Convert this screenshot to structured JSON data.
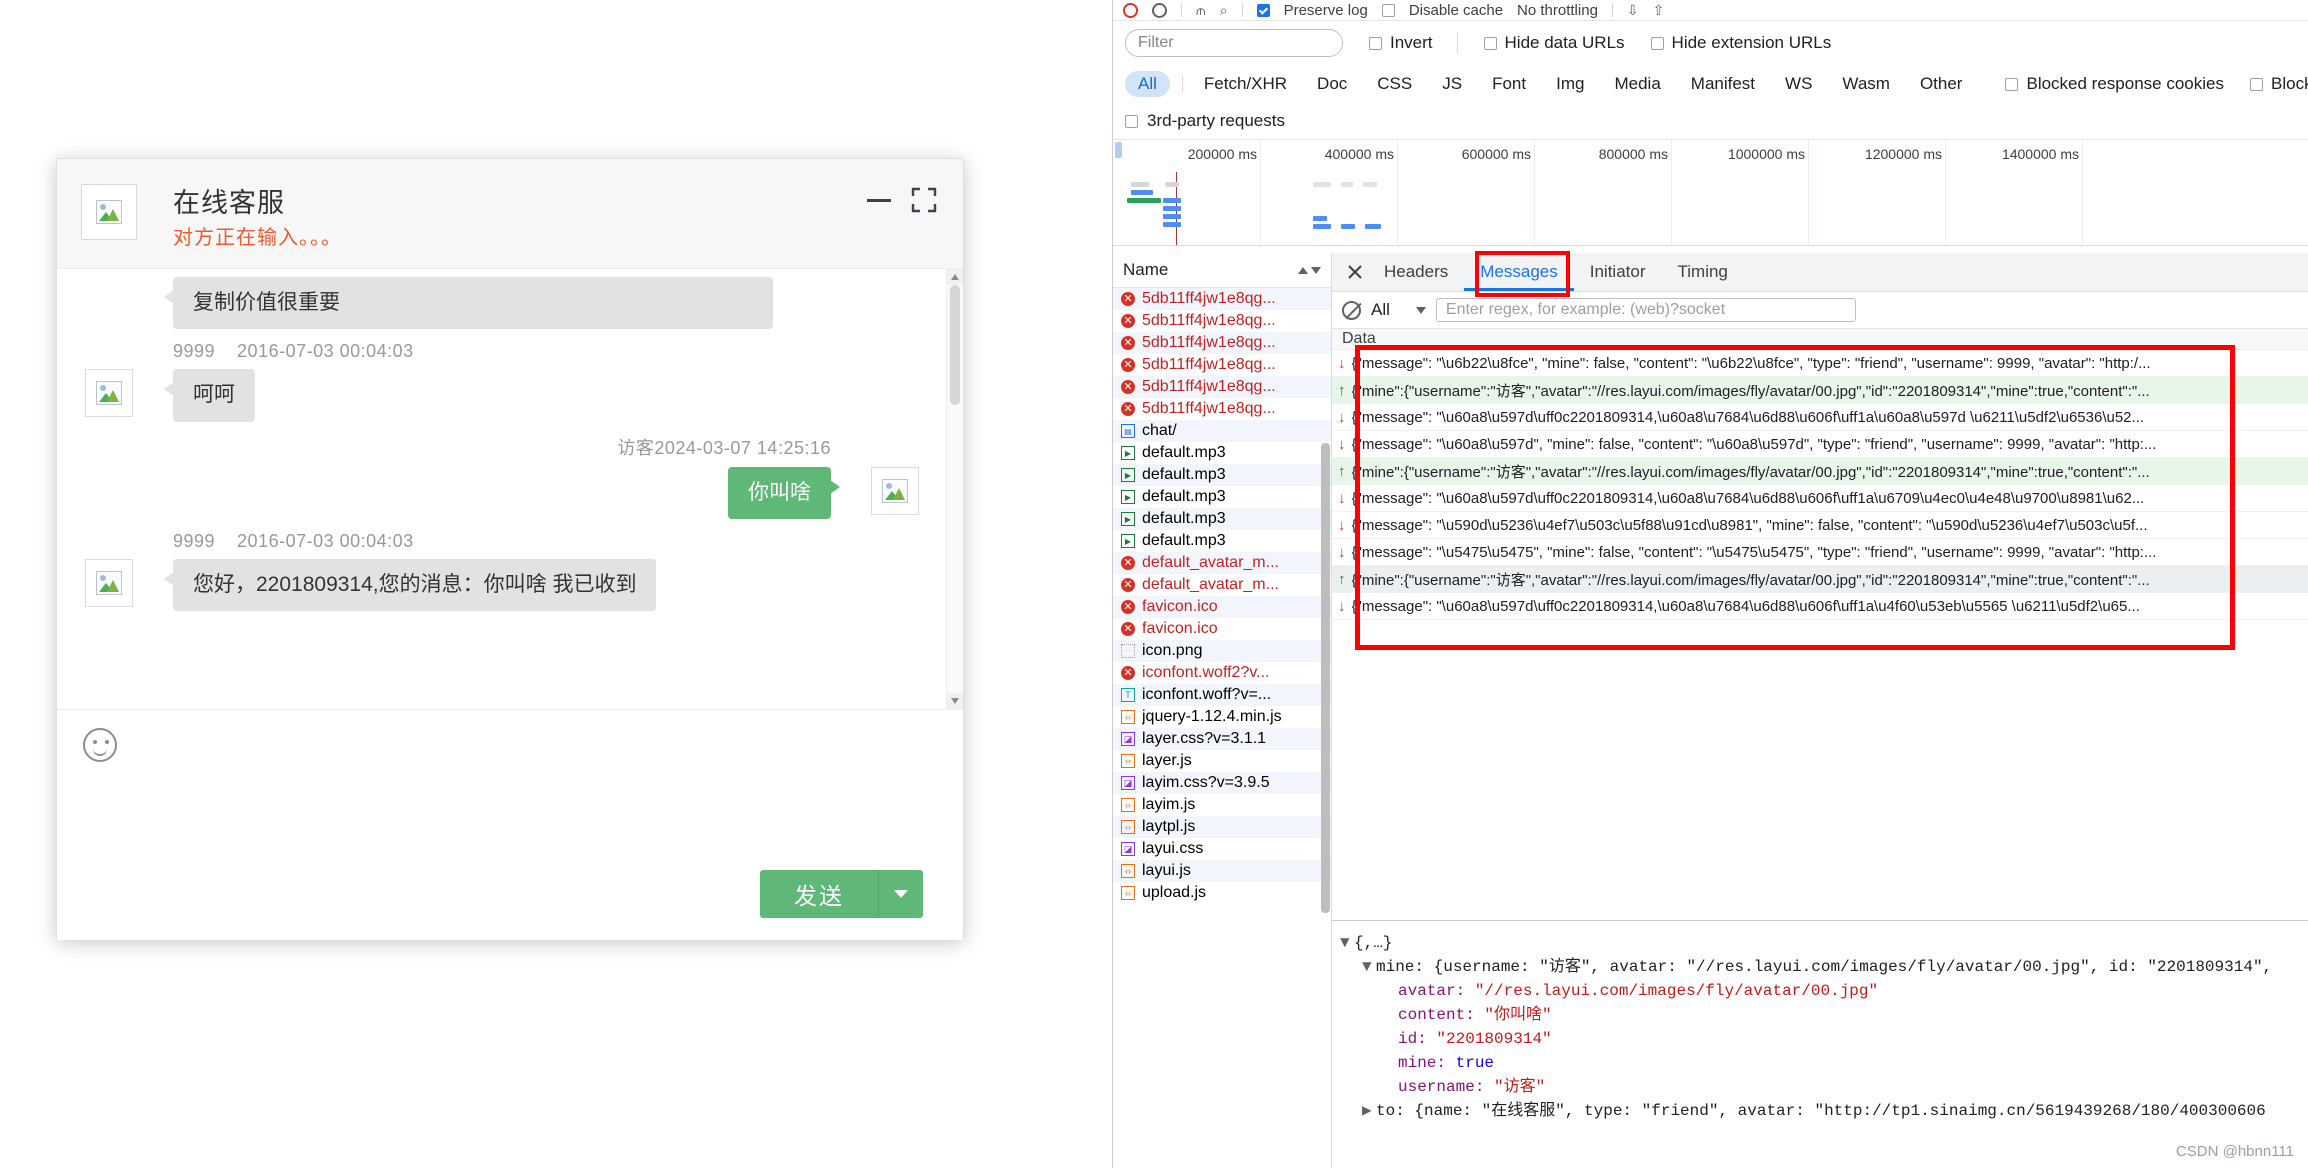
{
  "chat": {
    "title": "在线客服",
    "subtitle": "对方正在输入。。。",
    "minimize_icon": "minimize-icon",
    "maximize_icon": "maximize-icon",
    "emoji_icon": "smiley-face-icon",
    "send_label": "发送",
    "send_caret_icon": "chevron-down-icon",
    "scroll_up_icon": "scroll-up-arrow-icon",
    "scroll_down_icon": "scroll-down-arrow-icon",
    "messages": [
      {
        "id": "m0",
        "mine": false,
        "clipped": true,
        "name": "",
        "time": "",
        "content": "复制价值很重要"
      },
      {
        "id": "m1",
        "mine": false,
        "clipped": false,
        "name": "9999",
        "time": "2016-07-03 00:04:03",
        "content": "呵呵"
      },
      {
        "id": "m2",
        "mine": true,
        "clipped": false,
        "name": "访客",
        "time": "2024-03-07 14:25:16",
        "content": "你叫啥"
      },
      {
        "id": "m3",
        "mine": false,
        "clipped": false,
        "name": "9999",
        "time": "2016-07-03 00:04:03",
        "content": "您好，2201809314,您的消息：你叫啥 我已收到"
      }
    ]
  },
  "devtools": {
    "toolbar": {
      "record_icon": "record-circle-icon",
      "clear_icon": "clear-circle-icon",
      "filter_icon": "filter-funnel-icon",
      "search_icon": "search-icon",
      "preserve_log_label": "Preserve log",
      "preserve_log_checked": true,
      "disable_cache_label": "Disable cache",
      "disable_cache_checked": false,
      "throttling_label": "No throttling",
      "import_icon": "import-har-icon",
      "export_icon": "export-har-icon"
    },
    "filters": {
      "filter_placeholder": "Filter",
      "filter_value": "",
      "invert_label": "Invert",
      "invert_checked": false,
      "hide_data_urls_label": "Hide data URLs",
      "hide_data_urls_checked": false,
      "hide_extension_urls_label": "Hide extension URLs",
      "hide_extension_urls_checked": false,
      "blocked_response_cookies_label": "Blocked response cookies",
      "blocked_response_cookies_checked": false,
      "blocked_requests_label": "Blocked requests",
      "blocked_requests_checked": false,
      "third_party_label": "3rd-party requests",
      "third_party_checked": false,
      "types": [
        "All",
        "Fetch/XHR",
        "Doc",
        "CSS",
        "JS",
        "Font",
        "Img",
        "Media",
        "Manifest",
        "WS",
        "Wasm",
        "Other"
      ],
      "active_type": "All"
    },
    "overview": {
      "ticks": [
        "200000 ms",
        "400000 ms",
        "600000 ms",
        "800000 ms",
        "1000000 ms",
        "1200000 ms",
        "1400000 ms"
      ]
    },
    "names_panel": {
      "header": "Name",
      "sort_icon": "sort-arrows-icon",
      "rows": [
        {
          "icon": "error-icon",
          "kind": "err",
          "label": "5db11ff4jw1e8qg..."
        },
        {
          "icon": "error-icon",
          "kind": "err",
          "label": "5db11ff4jw1e8qg..."
        },
        {
          "icon": "error-icon",
          "kind": "err",
          "label": "5db11ff4jw1e8qg..."
        },
        {
          "icon": "error-icon",
          "kind": "err",
          "label": "5db11ff4jw1e8qg..."
        },
        {
          "icon": "error-icon",
          "kind": "err",
          "label": "5db11ff4jw1e8qg..."
        },
        {
          "icon": "error-icon",
          "kind": "err",
          "label": "5db11ff4jw1e8qg..."
        },
        {
          "icon": "document-icon",
          "kind": "doc",
          "label": "chat/"
        },
        {
          "icon": "media-icon",
          "kind": "media",
          "label": "default.mp3"
        },
        {
          "icon": "media-icon",
          "kind": "media",
          "label": "default.mp3"
        },
        {
          "icon": "media-icon",
          "kind": "media",
          "label": "default.mp3"
        },
        {
          "icon": "media-icon",
          "kind": "media",
          "label": "default.mp3"
        },
        {
          "icon": "media-icon",
          "kind": "media",
          "label": "default.mp3"
        },
        {
          "icon": "error-icon",
          "kind": "err",
          "label": "default_avatar_m..."
        },
        {
          "icon": "error-icon",
          "kind": "err",
          "label": "default_avatar_m..."
        },
        {
          "icon": "error-icon",
          "kind": "err",
          "label": "favicon.ico"
        },
        {
          "icon": "error-icon",
          "kind": "err",
          "label": "favicon.ico"
        },
        {
          "icon": "image-icon",
          "kind": "img",
          "label": "icon.png"
        },
        {
          "icon": "error-icon",
          "kind": "err",
          "label": "iconfont.woff2?v..."
        },
        {
          "icon": "font-icon",
          "kind": "font",
          "label": "iconfont.woff?v=..."
        },
        {
          "icon": "script-icon",
          "kind": "js",
          "label": "jquery-1.12.4.min.js"
        },
        {
          "icon": "stylesheet-icon",
          "kind": "css",
          "label": "layer.css?v=3.1.1"
        },
        {
          "icon": "script-icon",
          "kind": "js",
          "label": "layer.js"
        },
        {
          "icon": "stylesheet-icon",
          "kind": "css",
          "label": "layim.css?v=3.9.5"
        },
        {
          "icon": "script-icon",
          "kind": "js",
          "label": "layim.js"
        },
        {
          "icon": "script-icon",
          "kind": "js",
          "label": "laytpl.js"
        },
        {
          "icon": "stylesheet-icon",
          "kind": "css",
          "label": "layui.css"
        },
        {
          "icon": "script-icon",
          "kind": "js",
          "label": "layui.js"
        },
        {
          "icon": "script-icon",
          "kind": "js",
          "label": "upload.js"
        }
      ]
    },
    "detail_panel": {
      "close_icon": "close-icon",
      "tabs": [
        "Headers",
        "Messages",
        "Initiator",
        "Timing"
      ],
      "active_tab": "Messages",
      "message_filter": {
        "block_icon": "no-entry-icon",
        "select_value": "All",
        "select_caret_icon": "chevron-down-icon",
        "regex_placeholder": "Enter regex, for example: (web)?socket",
        "regex_value": ""
      },
      "data_header": "Data",
      "ws_messages": [
        {
          "dir": "recv",
          "arrow": "down-arrow-icon",
          "text": "{\"message\": \"\\u6b22\\u8fce\", \"mine\": false, \"content\": \"\\u6b22\\u8fce\", \"type\": \"friend\", \"username\": 9999, \"avatar\": \"http:/..."
        },
        {
          "dir": "sent",
          "arrow": "up-arrow-icon",
          "text": "{\"mine\":{\"username\":\"访客\",\"avatar\":\"//res.layui.com/images/fly/avatar/00.jpg\",\"id\":\"2201809314\",\"mine\":true,\"content\":\"..."
        },
        {
          "dir": "recv",
          "arrow": "down-arrow-icon",
          "text": "{\"message\": \"\\u60a8\\u597d\\uff0c2201809314,\\u60a8\\u7684\\u6d88\\u606f\\uff1a\\u60a8\\u597d \\u6211\\u5df2\\u6536\\u52..."
        },
        {
          "dir": "recv",
          "arrow": "down-arrow-icon",
          "text": "{\"message\": \"\\u60a8\\u597d\", \"mine\": false, \"content\": \"\\u60a8\\u597d\", \"type\": \"friend\", \"username\": 9999, \"avatar\": \"http:..."
        },
        {
          "dir": "sent",
          "arrow": "up-arrow-icon",
          "text": "{\"mine\":{\"username\":\"访客\",\"avatar\":\"//res.layui.com/images/fly/avatar/00.jpg\",\"id\":\"2201809314\",\"mine\":true,\"content\":\"..."
        },
        {
          "dir": "recv",
          "arrow": "down-arrow-icon",
          "text": "{\"message\": \"\\u60a8\\u597d\\uff0c2201809314,\\u60a8\\u7684\\u6d88\\u606f\\uff1a\\u6709\\u4ec0\\u4e48\\u9700\\u8981\\u62..."
        },
        {
          "dir": "recv",
          "arrow": "down-arrow-icon",
          "text": "{\"message\": \"\\u590d\\u5236\\u4ef7\\u503c\\u5f88\\u91cd\\u8981\", \"mine\": false, \"content\": \"\\u590d\\u5236\\u4ef7\\u503c\\u5f..."
        },
        {
          "dir": "recv",
          "arrow": "down-arrow-icon",
          "text": "{\"message\": \"\\u5475\\u5475\", \"mine\": false, \"content\": \"\\u5475\\u5475\", \"type\": \"friend\", \"username\": 9999, \"avatar\": \"http:..."
        },
        {
          "dir": "sel",
          "arrow": "up-arrow-icon",
          "text": "{\"mine\":{\"username\":\"访客\",\"avatar\":\"//res.layui.com/images/fly/avatar/00.jpg\",\"id\":\"2201809314\",\"mine\":true,\"content\":\"..."
        },
        {
          "dir": "recv",
          "arrow": "down-arrow-icon",
          "text": "{\"message\": \"\\u60a8\\u597d\\uff0c2201809314,\\u60a8\\u7684\\u6d88\\u606f\\uff1a\\u4f60\\u53eb\\u5565 \\u6211\\u5df2\\u65..."
        }
      ],
      "json_tree": {
        "root": "{,…}",
        "mine_summary": "mine: {username: \"访客\", avatar: \"//res.layui.com/images/fly/avatar/00.jpg\", id: \"2201809314\",",
        "avatar_key": "avatar:",
        "avatar_val": "\"//res.layui.com/images/fly/avatar/00.jpg\"",
        "content_key": "content:",
        "content_val": "\"你叫啥\"",
        "id_key": "id:",
        "id_val": "\"2201809314\"",
        "mine_key": "mine:",
        "mine_val": "true",
        "username_key": "username:",
        "username_val": "\"访客\"",
        "to_line": "to: {name: \"在线客服\", type: \"friend\", avatar: \"http://tp1.sinaimg.cn/5619439268/180/400300606"
      }
    },
    "watermark": "CSDN @hbnn111"
  },
  "colors": {
    "accent": "#1a73e8",
    "send_green": "#5FB878",
    "typing_orange": "#ef5c2a",
    "error_red": "#d93025",
    "highlight_box": "#ff0000",
    "sent_row_bg": "#e8f5e9"
  }
}
